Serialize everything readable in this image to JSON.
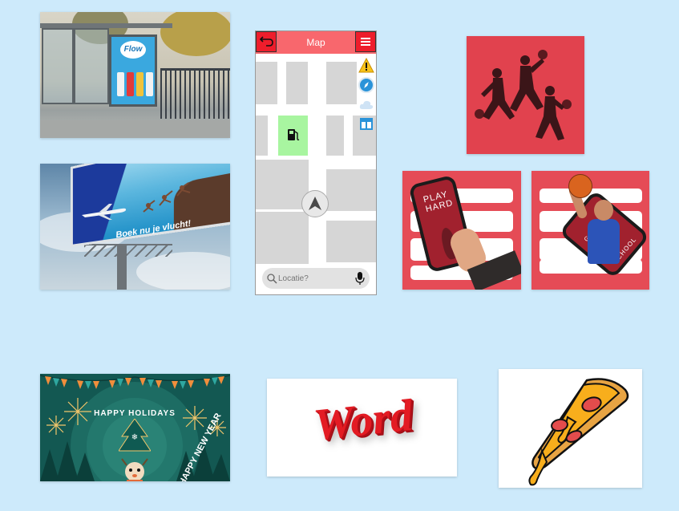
{
  "canvas": {
    "background": "#cdeafb"
  },
  "tiles": {
    "bus_stop": {
      "poster_logo": "Flow"
    },
    "billboard": {
      "slogan": "Boek nu je vlucht!"
    },
    "map_app": {
      "title": "Map",
      "search_placeholder": "Locatie?",
      "icons": [
        "back-arrow-icon",
        "hamburger-menu-icon",
        "warning-icon",
        "compass-icon",
        "cloud-icon",
        "layers-icon",
        "gas-station-icon",
        "navigation-arrow-icon",
        "search-icon",
        "microphone-icon"
      ]
    },
    "basketball_art": {},
    "promo_phone_left": {
      "phone_text": "PLAY HARD"
    },
    "promo_phone_right": {
      "phone_text_a": "GAME ON",
      "phone_text_b": "SCHOOL"
    },
    "holidays": {
      "caption": "HAPPY HOLIDAYS",
      "sub_caption": "HAPPY NEW YEAR"
    },
    "word_3d": {
      "text": "Word"
    },
    "pizza": {}
  },
  "colors": {
    "accent_red": "#e54b56",
    "map_bar": "#f8676d",
    "map_button": "#ee1d2b",
    "gas_block": "#a8f5a0",
    "holiday_bg": "#135852",
    "pizza_yellow": "#f8ae1c"
  }
}
